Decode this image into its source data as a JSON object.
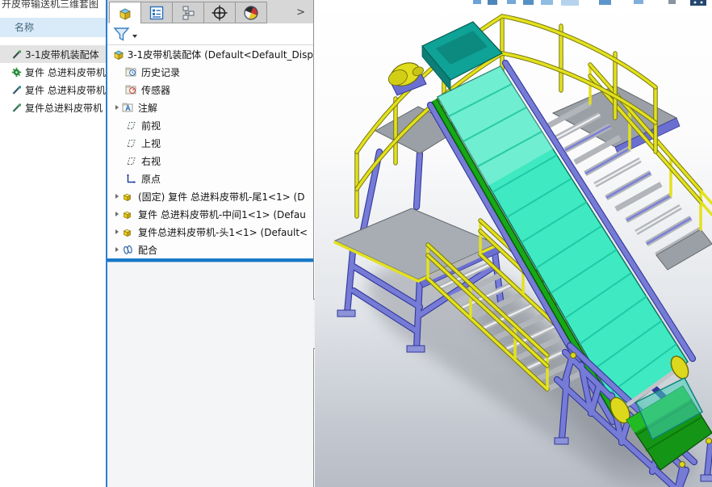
{
  "background_window": {
    "title": "开皮带输送机三维套图",
    "list_header": "名称",
    "items": [
      {
        "label": "3-1皮带机装配体",
        "icon": "part-document-icon",
        "selected": true
      },
      {
        "label": "复件 总进料皮带机",
        "icon": "component-green-icon",
        "selected": false
      },
      {
        "label": "复件 总进料皮带机",
        "icon": "part-document-icon",
        "selected": false
      },
      {
        "label": "复件总进料皮带机",
        "icon": "part-document-icon",
        "selected": false
      }
    ]
  },
  "feature_panel": {
    "tabs": [
      {
        "icon": "featuremanager-tree-icon",
        "active": true
      },
      {
        "icon": "propertymanager-icon",
        "active": false
      },
      {
        "icon": "configurationmanager-icon",
        "active": false
      },
      {
        "icon": "dimxpertmanager-icon",
        "active": false
      },
      {
        "icon": "displaymanager-icon",
        "active": false
      }
    ],
    "overflow_label": ">",
    "filter": {
      "icon": "filter-funnel-icon",
      "value": ""
    },
    "tree": {
      "root_label": "3-1皮带机装配体  (Default<Default_Disp",
      "items": [
        {
          "label": "历史记录",
          "icon": "history-folder-icon",
          "expandable": false
        },
        {
          "label": "传感器",
          "icon": "sensors-folder-icon",
          "expandable": false
        },
        {
          "label": "注解",
          "icon": "annotations-folder-icon",
          "expandable": true
        },
        {
          "label": "前视",
          "icon": "plane-icon",
          "expandable": false
        },
        {
          "label": "上视",
          "icon": "plane-icon",
          "expandable": false
        },
        {
          "label": "右视",
          "icon": "plane-icon",
          "expandable": false
        },
        {
          "label": "原点",
          "icon": "origin-icon",
          "expandable": false
        },
        {
          "label": "(固定) 复件 总进料皮带机-尾1<1> (D",
          "icon": "component-icon",
          "expandable": true
        },
        {
          "label": "复件 总进料皮带机-中间1<1> (Defau",
          "icon": "component-icon",
          "expandable": true
        },
        {
          "label": "复件总进料皮带机-头1<1> (Default<",
          "icon": "component-icon",
          "expandable": true
        },
        {
          "label": "配合",
          "icon": "mates-paperclip-icon",
          "expandable": true
        }
      ]
    }
  },
  "viewport": {
    "colors": {
      "rollback_bar_blue": "#1878c8",
      "window_edge_blue": "#2a7fd4",
      "belt_teal": "#3fe9c2",
      "frame_purple": "#7b80d8",
      "railing_yellow": "#e3e11d",
      "tail_belt_green": "#17a517",
      "deck_gray": "#9aa0a5",
      "header_blue": "#d9eaf8"
    }
  }
}
